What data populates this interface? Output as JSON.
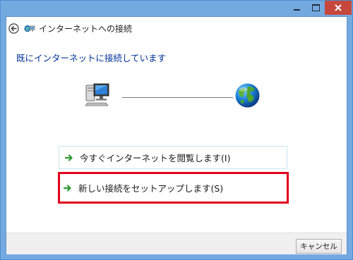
{
  "window": {
    "title": "インターネットへの接続",
    "controls": {
      "minimize_icon": "minimize-icon",
      "maximize_icon": "maximize-icon",
      "close_icon": "close-icon",
      "close_color": "#c7473c"
    }
  },
  "content": {
    "heading": "既にインターネットに接続しています",
    "heading_color": "#003399",
    "connection": {
      "left_icon": "computer-icon",
      "right_icon": "globe-icon"
    },
    "options": [
      {
        "label": "今すぐインターネットを閲覧します(I)",
        "icon": "green-arrow-icon",
        "highlighted": false
      },
      {
        "label": "新しい接続をセットアップします(S)",
        "icon": "green-arrow-icon",
        "highlighted": true,
        "highlight_color": "#e0001b"
      }
    ]
  },
  "footer": {
    "cancel_label": "キャンセル"
  }
}
